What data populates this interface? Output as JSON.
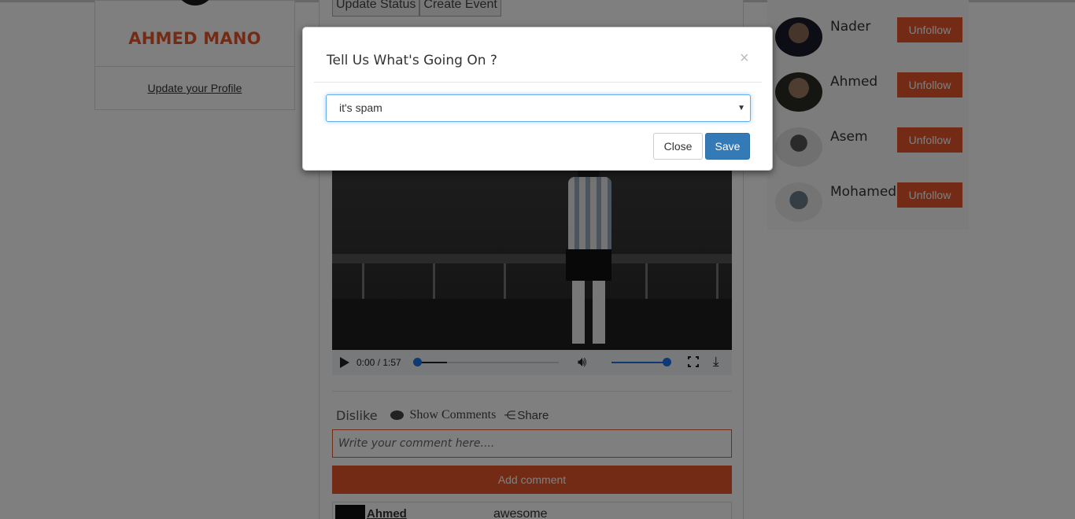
{
  "profile": {
    "name": "AHMED MANO",
    "update_link": "Update your Profile"
  },
  "feed": {
    "tabs": [
      "Update Status",
      "Create Event"
    ],
    "video": {
      "time": "0:00 / 1:57",
      "progress_fraction": 0.0,
      "volume_fraction": 1.0,
      "volume_icon": "volume-icon",
      "fullscreen_icon": "fullscreen-icon",
      "download_icon": "download-icon"
    },
    "actions": {
      "dislike": "Dislike",
      "show_comments": "Show Comments",
      "share": "Share"
    },
    "comment_placeholder": "Write your comment here....",
    "add_comment": "Add comment",
    "comments": [
      {
        "author": "Ahmed",
        "text": "awesome"
      }
    ]
  },
  "following": [
    {
      "name": "Nader",
      "button": "Unfollow"
    },
    {
      "name": "Ahmed",
      "button": "Unfollow"
    },
    {
      "name": "Asem",
      "button": "Unfollow"
    },
    {
      "name": "Mohamed",
      "button": "Unfollow"
    }
  ],
  "modal": {
    "title": "Tell Us What's Going On ?",
    "close_x": "×",
    "select_value": "it's spam",
    "close_button": "Close",
    "save_button": "Save"
  },
  "colors": {
    "accent": "#e8572a",
    "primary": "#337ab7",
    "overlay": "rgba(0,0,0,0.5)"
  }
}
